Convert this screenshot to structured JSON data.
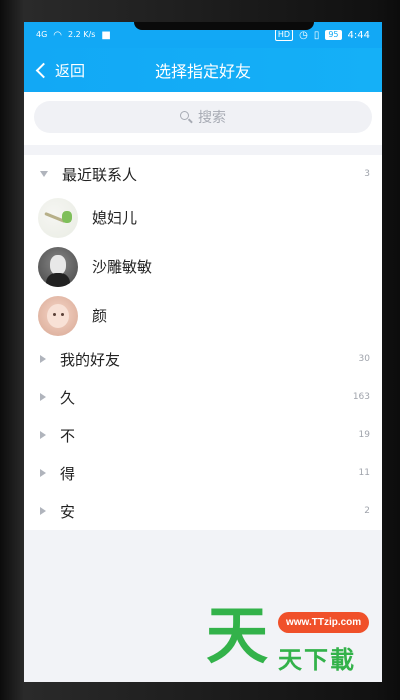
{
  "status_bar": {
    "left_net": "4G",
    "speed": "2.2 K/s",
    "hd": "HD",
    "battery": "95",
    "time": "4:44"
  },
  "title_bar": {
    "back_label": "返回",
    "title": "选择指定好友"
  },
  "search": {
    "placeholder": "搜索"
  },
  "groups": [
    {
      "name": "最近联系人",
      "count": "3",
      "expanded": true
    },
    {
      "name": "我的好友",
      "count": "30",
      "expanded": false
    },
    {
      "name": "久",
      "count": "163",
      "expanded": false
    },
    {
      "name": "不",
      "count": "19",
      "expanded": false
    },
    {
      "name": "得",
      "count": "11",
      "expanded": false
    },
    {
      "name": "安",
      "count": "2",
      "expanded": false
    }
  ],
  "recent_contacts": [
    {
      "name": "媳妇儿"
    },
    {
      "name": "沙雕敏敏"
    },
    {
      "name": "颜"
    }
  ],
  "watermark": {
    "big_char": "天",
    "url": "www.TTzip.com",
    "text": "天下載"
  },
  "colors": {
    "accent": "#12a8f5",
    "watermark_green": "#33b24a",
    "watermark_orange": "#f0502a"
  }
}
